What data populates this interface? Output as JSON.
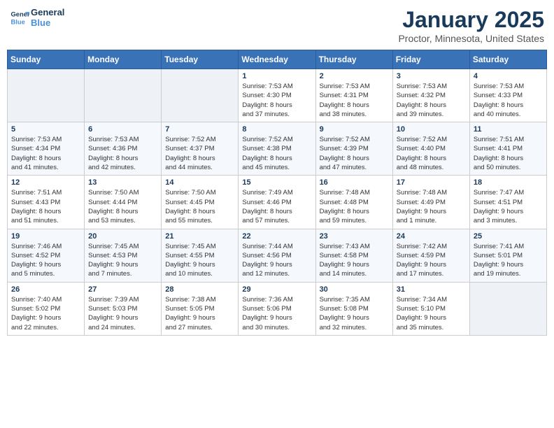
{
  "header": {
    "logo_line1": "General",
    "logo_line2": "Blue",
    "month": "January 2025",
    "location": "Proctor, Minnesota, United States"
  },
  "weekdays": [
    "Sunday",
    "Monday",
    "Tuesday",
    "Wednesday",
    "Thursday",
    "Friday",
    "Saturday"
  ],
  "weeks": [
    [
      {
        "day": "",
        "info": ""
      },
      {
        "day": "",
        "info": ""
      },
      {
        "day": "",
        "info": ""
      },
      {
        "day": "1",
        "info": "Sunrise: 7:53 AM\nSunset: 4:30 PM\nDaylight: 8 hours\nand 37 minutes."
      },
      {
        "day": "2",
        "info": "Sunrise: 7:53 AM\nSunset: 4:31 PM\nDaylight: 8 hours\nand 38 minutes."
      },
      {
        "day": "3",
        "info": "Sunrise: 7:53 AM\nSunset: 4:32 PM\nDaylight: 8 hours\nand 39 minutes."
      },
      {
        "day": "4",
        "info": "Sunrise: 7:53 AM\nSunset: 4:33 PM\nDaylight: 8 hours\nand 40 minutes."
      }
    ],
    [
      {
        "day": "5",
        "info": "Sunrise: 7:53 AM\nSunset: 4:34 PM\nDaylight: 8 hours\nand 41 minutes."
      },
      {
        "day": "6",
        "info": "Sunrise: 7:53 AM\nSunset: 4:36 PM\nDaylight: 8 hours\nand 42 minutes."
      },
      {
        "day": "7",
        "info": "Sunrise: 7:52 AM\nSunset: 4:37 PM\nDaylight: 8 hours\nand 44 minutes."
      },
      {
        "day": "8",
        "info": "Sunrise: 7:52 AM\nSunset: 4:38 PM\nDaylight: 8 hours\nand 45 minutes."
      },
      {
        "day": "9",
        "info": "Sunrise: 7:52 AM\nSunset: 4:39 PM\nDaylight: 8 hours\nand 47 minutes."
      },
      {
        "day": "10",
        "info": "Sunrise: 7:52 AM\nSunset: 4:40 PM\nDaylight: 8 hours\nand 48 minutes."
      },
      {
        "day": "11",
        "info": "Sunrise: 7:51 AM\nSunset: 4:41 PM\nDaylight: 8 hours\nand 50 minutes."
      }
    ],
    [
      {
        "day": "12",
        "info": "Sunrise: 7:51 AM\nSunset: 4:43 PM\nDaylight: 8 hours\nand 51 minutes."
      },
      {
        "day": "13",
        "info": "Sunrise: 7:50 AM\nSunset: 4:44 PM\nDaylight: 8 hours\nand 53 minutes."
      },
      {
        "day": "14",
        "info": "Sunrise: 7:50 AM\nSunset: 4:45 PM\nDaylight: 8 hours\nand 55 minutes."
      },
      {
        "day": "15",
        "info": "Sunrise: 7:49 AM\nSunset: 4:46 PM\nDaylight: 8 hours\nand 57 minutes."
      },
      {
        "day": "16",
        "info": "Sunrise: 7:48 AM\nSunset: 4:48 PM\nDaylight: 8 hours\nand 59 minutes."
      },
      {
        "day": "17",
        "info": "Sunrise: 7:48 AM\nSunset: 4:49 PM\nDaylight: 9 hours\nand 1 minute."
      },
      {
        "day": "18",
        "info": "Sunrise: 7:47 AM\nSunset: 4:51 PM\nDaylight: 9 hours\nand 3 minutes."
      }
    ],
    [
      {
        "day": "19",
        "info": "Sunrise: 7:46 AM\nSunset: 4:52 PM\nDaylight: 9 hours\nand 5 minutes."
      },
      {
        "day": "20",
        "info": "Sunrise: 7:45 AM\nSunset: 4:53 PM\nDaylight: 9 hours\nand 7 minutes."
      },
      {
        "day": "21",
        "info": "Sunrise: 7:45 AM\nSunset: 4:55 PM\nDaylight: 9 hours\nand 10 minutes."
      },
      {
        "day": "22",
        "info": "Sunrise: 7:44 AM\nSunset: 4:56 PM\nDaylight: 9 hours\nand 12 minutes."
      },
      {
        "day": "23",
        "info": "Sunrise: 7:43 AM\nSunset: 4:58 PM\nDaylight: 9 hours\nand 14 minutes."
      },
      {
        "day": "24",
        "info": "Sunrise: 7:42 AM\nSunset: 4:59 PM\nDaylight: 9 hours\nand 17 minutes."
      },
      {
        "day": "25",
        "info": "Sunrise: 7:41 AM\nSunset: 5:01 PM\nDaylight: 9 hours\nand 19 minutes."
      }
    ],
    [
      {
        "day": "26",
        "info": "Sunrise: 7:40 AM\nSunset: 5:02 PM\nDaylight: 9 hours\nand 22 minutes."
      },
      {
        "day": "27",
        "info": "Sunrise: 7:39 AM\nSunset: 5:03 PM\nDaylight: 9 hours\nand 24 minutes."
      },
      {
        "day": "28",
        "info": "Sunrise: 7:38 AM\nSunset: 5:05 PM\nDaylight: 9 hours\nand 27 minutes."
      },
      {
        "day": "29",
        "info": "Sunrise: 7:36 AM\nSunset: 5:06 PM\nDaylight: 9 hours\nand 30 minutes."
      },
      {
        "day": "30",
        "info": "Sunrise: 7:35 AM\nSunset: 5:08 PM\nDaylight: 9 hours\nand 32 minutes."
      },
      {
        "day": "31",
        "info": "Sunrise: 7:34 AM\nSunset: 5:10 PM\nDaylight: 9 hours\nand 35 minutes."
      },
      {
        "day": "",
        "info": ""
      }
    ]
  ]
}
